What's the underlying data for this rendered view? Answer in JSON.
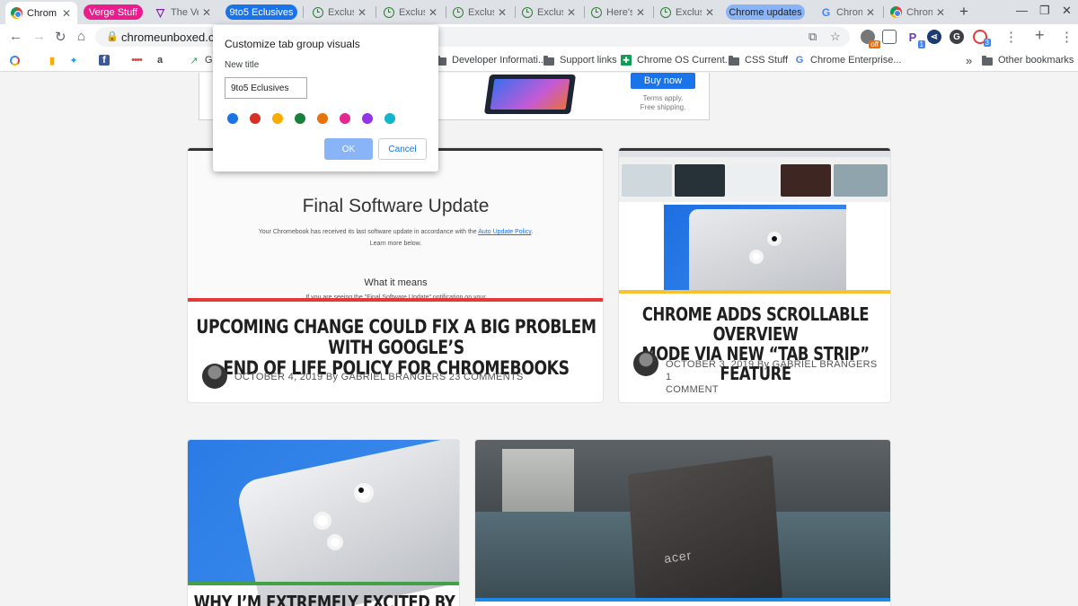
{
  "tabs": {
    "active": {
      "title": "Chrom"
    },
    "items": [
      {
        "title": "The Ve",
        "icon": "verge-icon"
      },
      {
        "title": "Exclus",
        "icon": "clock-icon"
      },
      {
        "title": "Exclus",
        "icon": "clock-icon"
      },
      {
        "title": "Exclus",
        "icon": "clock-icon"
      },
      {
        "title": "Exclus",
        "icon": "clock-icon"
      },
      {
        "title": "Here's",
        "icon": "clock-icon"
      },
      {
        "title": "Exclus",
        "icon": "clock-icon"
      },
      {
        "title": "Chron",
        "icon": "google-icon"
      },
      {
        "title": "Chron",
        "icon": "chrome-icon"
      }
    ],
    "groups": [
      {
        "label": "Verge Stuff",
        "color": "#e91e8c",
        "text_color": "#ffffff"
      },
      {
        "label": "9to5 Eclusives",
        "color": "#1a73e8",
        "text_color": "#ffffff"
      },
      {
        "label": "Chrome updates",
        "color": "#8ab4f8",
        "text_color": "#202124"
      }
    ],
    "close_glyph": "✕",
    "new_tab_glyph": "+"
  },
  "window": {
    "minimize": "—",
    "maximize": "❐",
    "close": "✕"
  },
  "toolbar": {
    "url": "chromeunboxed.com",
    "ext_badges": {
      "pocket": "1",
      "last": "3",
      "off": "off"
    }
  },
  "bookmarks": {
    "items": [
      {
        "label": "Developer Informati...",
        "icon": "folder-icon"
      },
      {
        "label": "Support links",
        "icon": "folder-icon"
      },
      {
        "label": "Chrome OS Current...",
        "icon": "sheets-icon"
      },
      {
        "label": "CSS Stuff",
        "icon": "folder-icon"
      },
      {
        "label": "Chrome Enterprise...",
        "icon": "google-icon"
      }
    ],
    "partial_g": "G",
    "overflow": "»",
    "other": "Other bookmarks"
  },
  "ad": {
    "buy": "Buy now",
    "terms_line1": "Terms apply.",
    "terms_line2": "Free shipping."
  },
  "cards": [
    {
      "shot_heading": "Final Software Update",
      "shot_line1_a": "Your Chromebook has received its last software update in accordance with the ",
      "shot_link": "Auto Update Policy",
      "shot_line1_b": ".",
      "shot_line2": "Learn more below.",
      "shot_subheading": "What it means",
      "shot_line3": "If you are seeing the \"Final Software Update\" notification on your",
      "title_line1": "Upcoming change could fix a big problem with Google’s",
      "title_line2": "end of life policy for Chromebooks",
      "date": "OCTOBER 4, 2019",
      "by": "By",
      "author": "GABRIEL BRANGERS",
      "comments": "23 COMMENTS",
      "bar_color": "#e53935"
    },
    {
      "title_line1": "Chrome adds scrollable overview",
      "title_line2": "mode via new “tab strip” feature",
      "date": "OCTOBER 3, 2019",
      "by": "By",
      "author": "GABRIEL BRANGERS",
      "comments_line1": "1",
      "comments_line2": "COMMENT",
      "bar_color": "#fbc02d"
    },
    {
      "title_line1": "Why I’m extremely excited by the",
      "bar_color": "#43a047"
    },
    {
      "logo": "acer",
      "bar_color": "#1e88e5"
    }
  ],
  "dialog": {
    "title": "Customize tab group visuals",
    "label": "New title",
    "value": "9to5 Eclusives",
    "colors": [
      "#1a73e8",
      "#d93025",
      "#f9ab00",
      "#188038",
      "#e8710a",
      "#e52592",
      "#9334e6",
      "#12b5cb"
    ],
    "ok": "OK",
    "cancel": "Cancel"
  }
}
